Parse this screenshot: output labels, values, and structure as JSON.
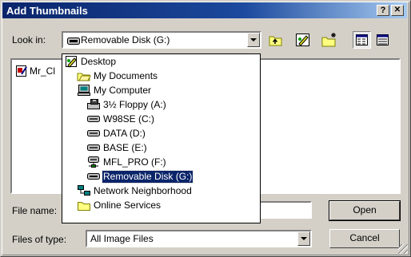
{
  "window": {
    "title": "Add Thumbnails",
    "help_label": "?",
    "close_label": "✕"
  },
  "look_in": {
    "label": "Look in:",
    "value": "Removable Disk (G:)"
  },
  "file_list": {
    "items": [
      "Mr_Cl"
    ]
  },
  "dropdown": {
    "items": [
      {
        "label": "Desktop",
        "icon": "desktop-icon"
      },
      {
        "label": "My Documents",
        "icon": "folder-open-icon"
      },
      {
        "label": "My Computer",
        "icon": "computer-icon"
      },
      {
        "label": "3½ Floppy (A:)",
        "icon": "floppy-drive-icon"
      },
      {
        "label": "W98SE (C:)",
        "icon": "hard-drive-icon"
      },
      {
        "label": "DATA (D:)",
        "icon": "hard-drive-icon"
      },
      {
        "label": "BASE (E:)",
        "icon": "hard-drive-icon"
      },
      {
        "label": "MFL_PRO (F:)",
        "icon": "network-drive-icon"
      },
      {
        "label": "Removable Disk (G:)",
        "icon": "removable-disk-icon",
        "selected": true
      },
      {
        "label": "Network Neighborhood",
        "icon": "network-icon"
      },
      {
        "label": "Online Services",
        "icon": "folder-icon"
      }
    ]
  },
  "file_name": {
    "label": "File name:",
    "value": ""
  },
  "file_type": {
    "label": "Files of type:",
    "value": "All Image Files"
  },
  "buttons": {
    "open": "Open",
    "cancel": "Cancel"
  },
  "colors": {
    "title_bar": "#0a246a",
    "selection": "#0a246a",
    "face": "#d4d0c8"
  }
}
